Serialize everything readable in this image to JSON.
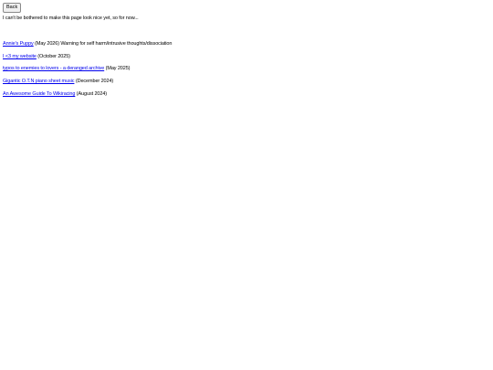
{
  "back_button": {
    "label": "Back"
  },
  "intro_text": "I can't be bothered to make this page look nice yet, so for now...",
  "entries": [
    {
      "link": "Annie's Puppy",
      "suffix": " (May 2026) Warning for self harm/intrusive thoughts/dissociation"
    },
    {
      "link": "I <3 my website",
      "suffix": " (October 2025)"
    },
    {
      "link": "typos to enemies to lovers - a deranged archive",
      "suffix": " (May 2025)"
    },
    {
      "link": "Gigantic O.T.N piano sheet music",
      "suffix": " (December 2024)"
    },
    {
      "link": "An Awesome Guide To Wikiracing",
      "suffix": " (August 2024)"
    }
  ],
  "colors": {
    "link": "#0000ee",
    "text": "#000000",
    "background": "#ffffff"
  }
}
